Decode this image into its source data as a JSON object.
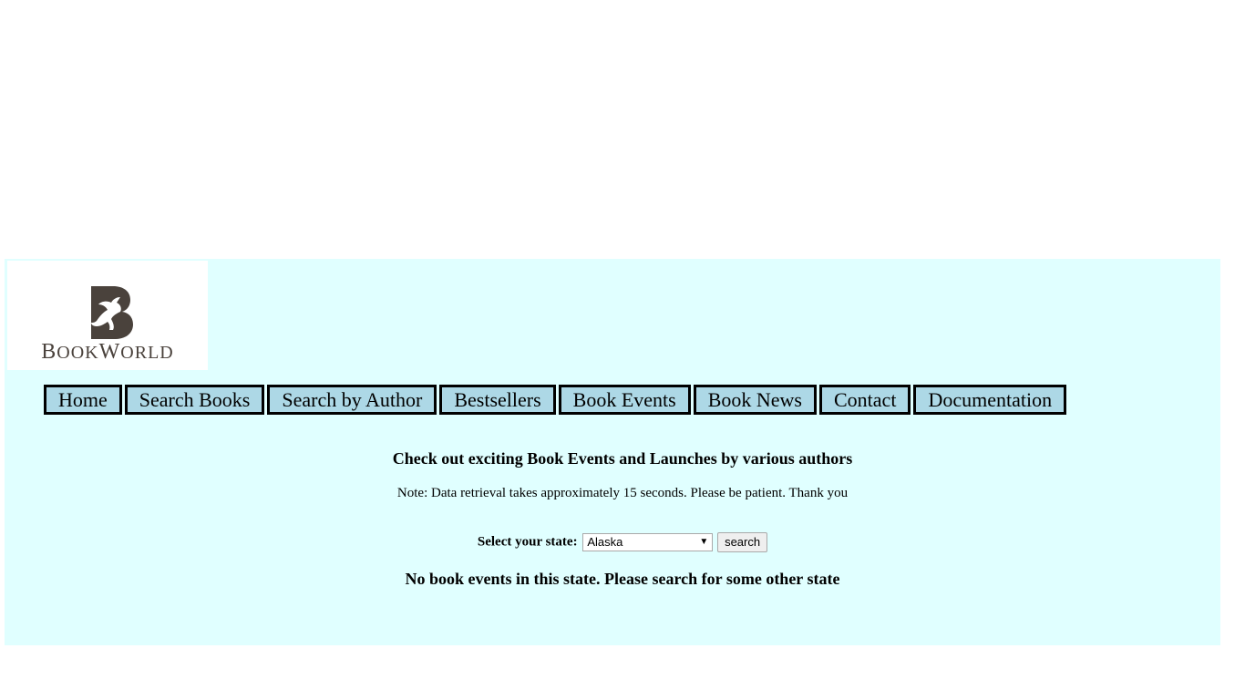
{
  "logo": {
    "icon": "horse-b-logo-icon",
    "text_big": "B",
    "text_rest1": "OOK",
    "text_big2": "W",
    "text_rest2": "ORLD",
    "color": "#4a423c"
  },
  "nav": {
    "items": [
      {
        "label": "Home"
      },
      {
        "label": "Search Books"
      },
      {
        "label": "Search by Author"
      },
      {
        "label": "Bestsellers"
      },
      {
        "label": "Book Events"
      },
      {
        "label": "Book News"
      },
      {
        "label": "Contact"
      },
      {
        "label": "Documentation"
      }
    ],
    "bg_color": "#add8e6"
  },
  "main": {
    "heading": "Check out exciting Book Events and Launches by various authors",
    "note": "Note: Data retrieval takes approximately 15 seconds. Please be patient. Thank you",
    "state_label": "Select your state:",
    "state_value": "Alaska",
    "search_label": "search",
    "result": "No book events in this state. Please search for some other state",
    "bg_color": "#e0ffff"
  }
}
